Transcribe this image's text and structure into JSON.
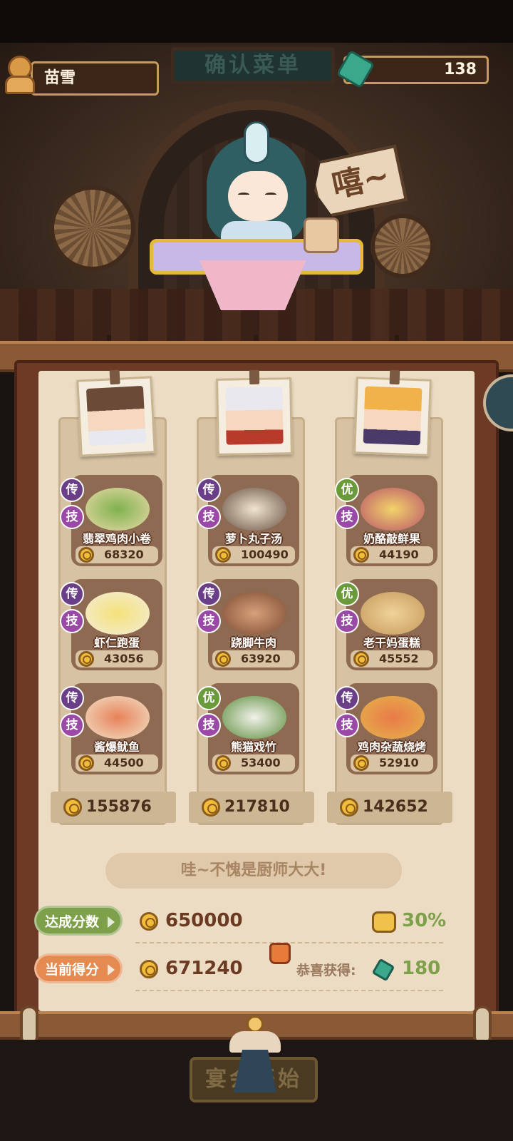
{
  "header": {
    "player_name": "苗雪",
    "title_sign": "确认菜单",
    "gems": "138"
  },
  "scene": {
    "speech_bubble": "嘻~"
  },
  "chefs": [
    {
      "total": "155876",
      "dishes": [
        {
          "grade": "传",
          "skill": "技",
          "name": "翡翠鸡肉小卷",
          "price": "68320"
        },
        {
          "grade": "传",
          "skill": "技",
          "name": "虾仁跑蛋",
          "price": "43056"
        },
        {
          "grade": "传",
          "skill": "技",
          "name": "酱爆鱿鱼",
          "price": "44500"
        }
      ]
    },
    {
      "total": "217810",
      "dishes": [
        {
          "grade": "传",
          "skill": "技",
          "name": "萝卜丸子汤",
          "price": "100490"
        },
        {
          "grade": "传",
          "skill": "技",
          "name": "跷脚牛肉",
          "price": "63920"
        },
        {
          "grade": "优",
          "skill": "技",
          "name": "熊猫戏竹",
          "price": "53400"
        }
      ]
    },
    {
      "total": "142652",
      "dishes": [
        {
          "grade": "优",
          "skill": "技",
          "name": "奶酪敲鲜果",
          "price": "44190"
        },
        {
          "grade": "优",
          "skill": "技",
          "name": "老干妈蛋糕",
          "price": "45552"
        },
        {
          "grade": "传",
          "skill": "技",
          "name": "鸡肉杂蔬烧烤",
          "price": "52910"
        }
      ]
    }
  ],
  "compliment": "哇~不愧是厨师大大!",
  "scores": {
    "target_label": "达成分数",
    "target_value": "650000",
    "bonus_percent": "30%",
    "current_label": "当前得分",
    "current_value": "671240",
    "congrats_label": "恭喜获得:",
    "reward_gems": "180"
  },
  "start_button": "宴会开始",
  "colors": {
    "legend_tag": "#6b3f88",
    "good_tag": "#6a9a3a",
    "skill_tag": "#9a4aa6",
    "score_green": "#7ea04a",
    "score_orange": "#e58a50"
  },
  "icons": [
    "player-avatar-icon",
    "gem-icon",
    "coin-icon",
    "thumbs-up-icon",
    "bonus-coin-icon"
  ]
}
